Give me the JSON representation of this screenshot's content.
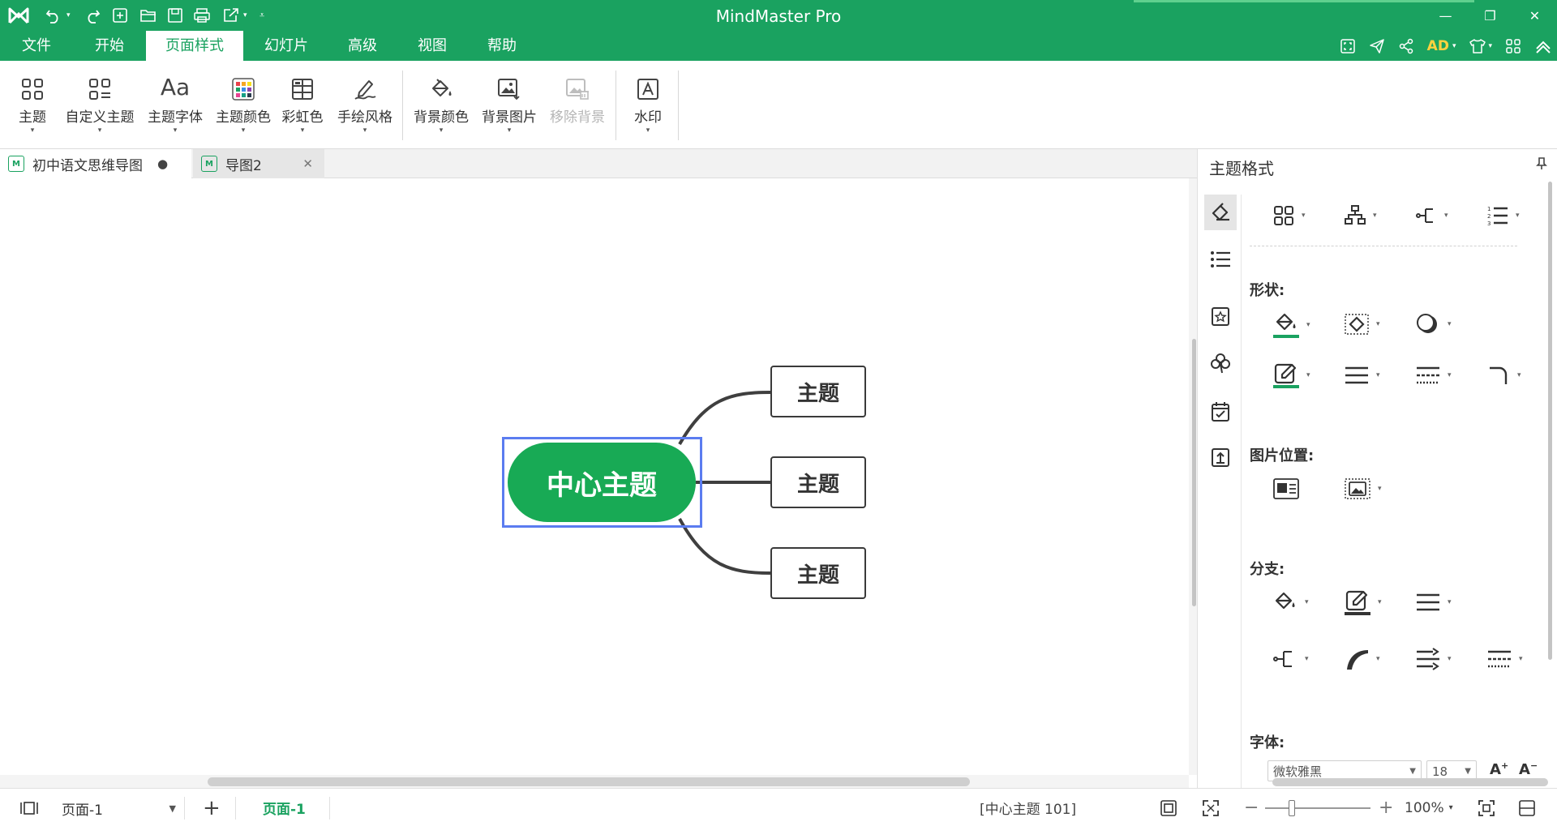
{
  "window": {
    "title": "MindMaster Pro"
  },
  "menu": {
    "tabs": [
      {
        "label": "文件"
      },
      {
        "label": "开始"
      },
      {
        "label": "页面样式"
      },
      {
        "label": "幻灯片"
      },
      {
        "label": "高级"
      },
      {
        "label": "视图"
      },
      {
        "label": "帮助"
      }
    ],
    "active_tab": "页面样式",
    "user": "AD"
  },
  "ribbon": {
    "theme": "主题",
    "custom_theme": "自定义主题",
    "theme_font": "主题字体",
    "theme_color": "主题颜色",
    "rainbow": "彩虹色",
    "hand_drawn": "手绘风格",
    "bg_color": "背景颜色",
    "bg_image": "背景图片",
    "remove_bg": "移除背景",
    "watermark": "水印"
  },
  "doc_tabs": [
    {
      "label": "初中语文思维导图",
      "modified": true
    },
    {
      "label": "导图2",
      "modified": false
    }
  ],
  "mindmap": {
    "central": "中心主题",
    "topics": [
      "主题",
      "主题",
      "主题"
    ]
  },
  "right_panel": {
    "title": "主题格式",
    "shape_label": "形状:",
    "image_pos_label": "图片位置:",
    "branch_label": "分支:",
    "font_label": "字体:",
    "font_family": "微软雅黑",
    "font_size": "18",
    "accent_color": "#1aa260"
  },
  "status": {
    "page_select": "页面-1",
    "page_tab": "页面-1",
    "selection": "[中心主题 101]",
    "zoom": "100%"
  },
  "colors": {
    "brand": "#1aa260",
    "central": "#18aa55",
    "selection": "#5b7cf0",
    "user": "#ffd23f"
  }
}
